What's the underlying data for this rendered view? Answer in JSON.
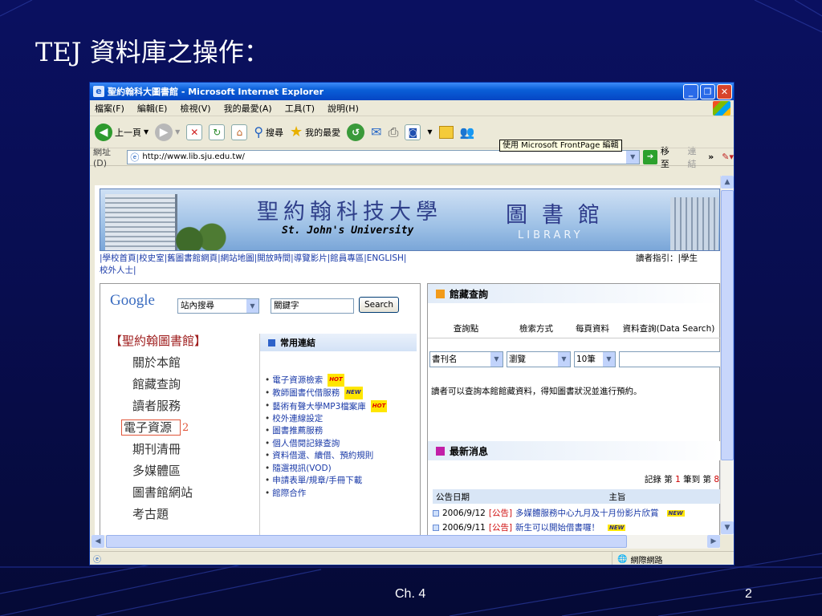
{
  "slide": {
    "title": "TEJ 資料庫之操作：",
    "footer_chapter": "Ch. 4",
    "footer_page": "2"
  },
  "window": {
    "title": "聖約翰科大圖書館 - Microsoft Internet Explorer",
    "menus": [
      "檔案(F)",
      "編輯(E)",
      "檢視(V)",
      "我的最愛(A)",
      "工具(T)",
      "說明(H)"
    ],
    "toolbar": {
      "back_label": "上一頁",
      "search_label": "搜尋",
      "favorites_label": "我的最愛",
      "tooltip": "使用 Microsoft FrontPage 編輯"
    },
    "address": {
      "label": "網址(D)",
      "url": "http://www.lib.sju.edu.tw/",
      "go_label": "移至",
      "links_label": "連結"
    },
    "status": {
      "zone": "網際網路"
    }
  },
  "site": {
    "banner": {
      "school_cn": "聖約翰科技大學",
      "school_en": "St. John's University",
      "library_cn": "圖書館",
      "library_en": "LIBRARY"
    },
    "nav_links": "|學校首頁|校史室|舊圖書館網頁|網站地圖|開放時間|導覽影片|館員專區|ENGLISH|",
    "nav_links_wrap": "校外人士|",
    "reader_guide": "讀者指引：|學生",
    "search": {
      "google": "Google",
      "scope": "站內搜尋",
      "keyword": "關鍵字",
      "button": "Search"
    },
    "left_menu": {
      "heading": "【聖約翰圖書館】",
      "items": [
        "關於本館",
        "館藏查詢",
        "讀者服務",
        "電子資源",
        "期刊清冊",
        "多媒體區",
        "圖書館網站",
        "考古題"
      ],
      "annotation": "2"
    },
    "links_box": {
      "heading": "常用連結",
      "items": [
        {
          "text": "電子資源檢索",
          "tag": "HOT"
        },
        {
          "text": "教師圖書代借服務",
          "tag": "NEW"
        },
        {
          "text": "藝術有聲大學MP3檔案庫",
          "tag": "HOT"
        },
        {
          "text": "校外連線設定",
          "tag": ""
        },
        {
          "text": "圖書推薦服務",
          "tag": ""
        },
        {
          "text": "個人借閱記錄查詢",
          "tag": ""
        },
        {
          "text": "資料借還、續借、預約規則",
          "tag": ""
        },
        {
          "text": "隨選視訊(VOD)",
          "tag": ""
        },
        {
          "text": "申請表單/規章/手冊下載",
          "tag": ""
        },
        {
          "text": "館際合作",
          "tag": ""
        }
      ]
    },
    "catalog": {
      "heading": "館藏查詢",
      "columns": [
        "查詢點",
        "檢索方式",
        "每頁資料",
        "資料查詢(Data Search)"
      ],
      "point_value": "書刊名",
      "method_value": "瀏覽",
      "per_page_value": "10筆",
      "desc": "讀者可以查詢本館館藏資料，得知圖書狀況並進行預約。"
    },
    "news": {
      "heading": "最新消息",
      "record_prefix": "記錄 第",
      "record_from": "1",
      "record_mid": "筆到 第",
      "record_to": "8",
      "col_date": "公告日期",
      "col_subject": "主旨",
      "rows": [
        {
          "date": "2006/9/12",
          "cat": "[公告]",
          "title": "多媒體服務中心九月及十月份影片欣賞",
          "tag": "NEW"
        },
        {
          "date": "2006/9/11",
          "cat": "[公告]",
          "title": "新生可以開始借書囉！",
          "tag": "NEW"
        }
      ]
    }
  }
}
